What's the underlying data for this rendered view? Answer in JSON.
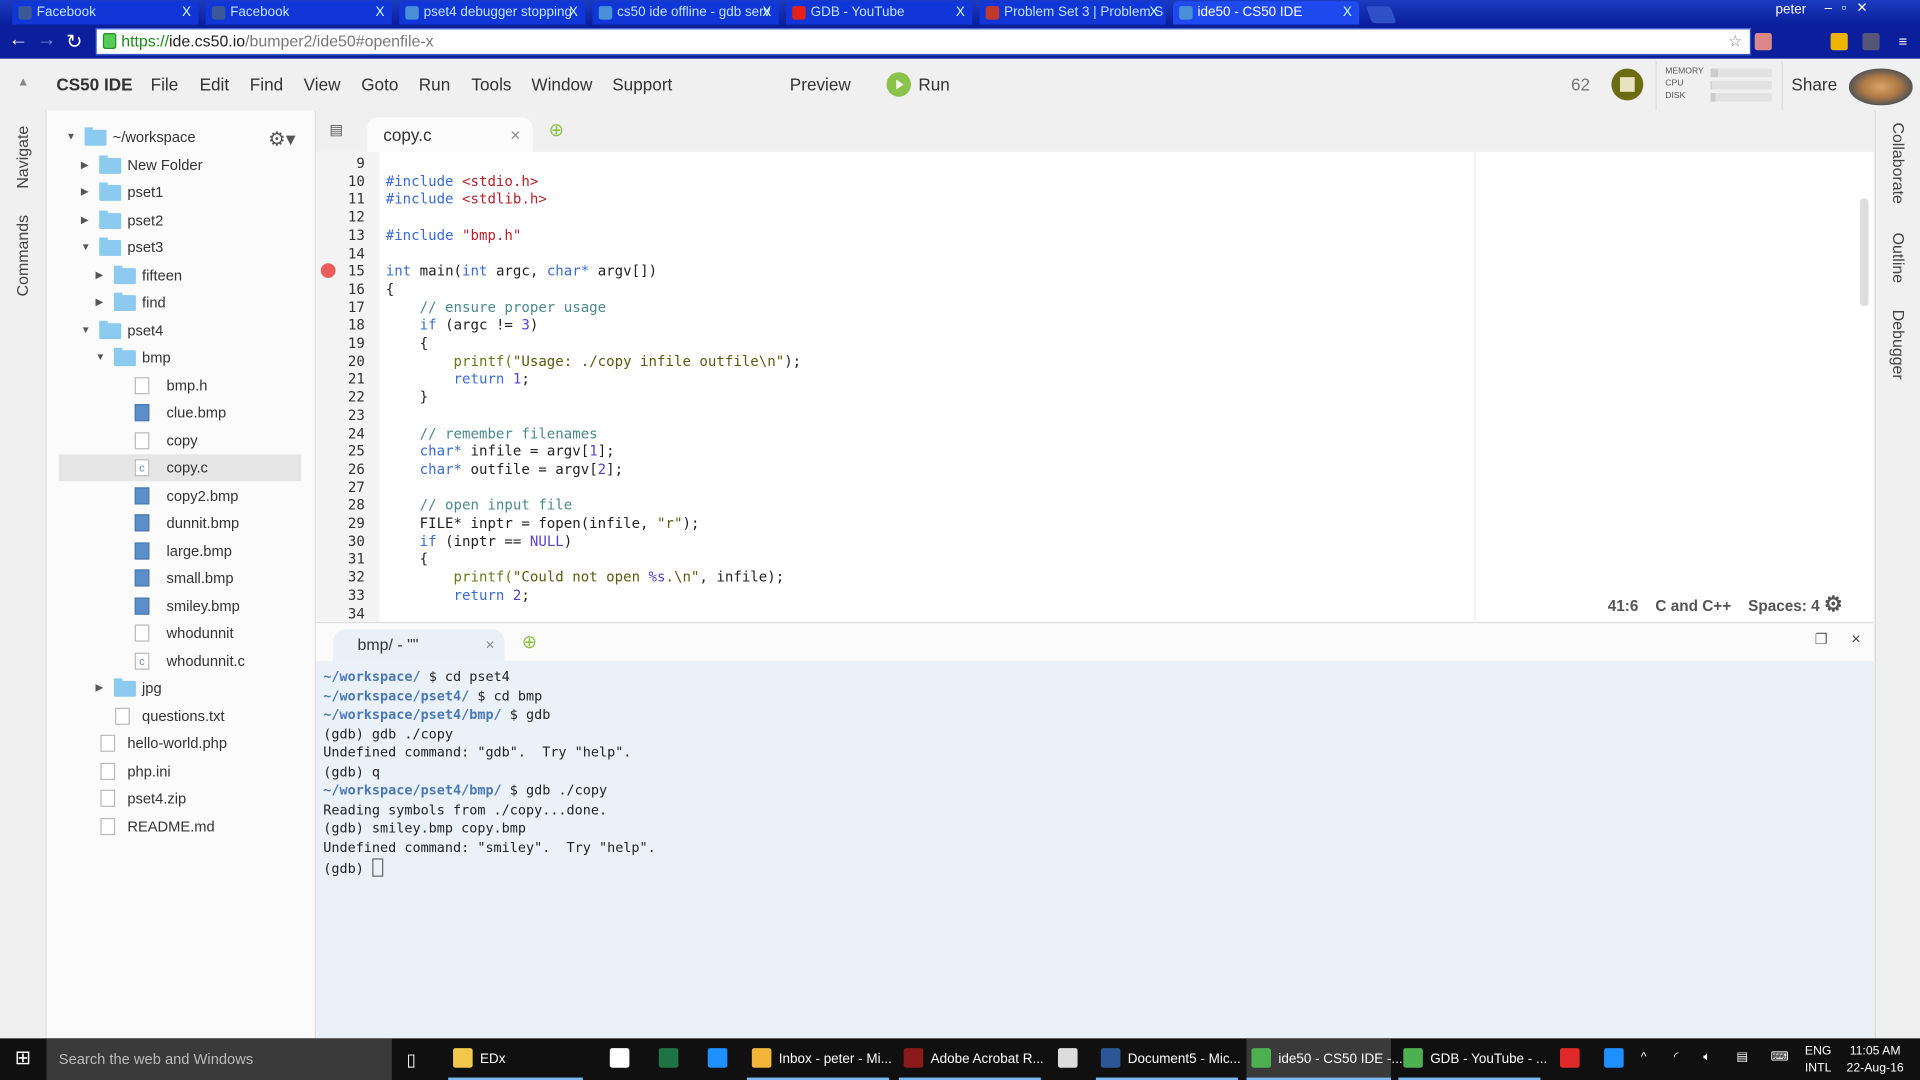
{
  "browser": {
    "tabs": [
      {
        "title": "Facebook",
        "icon": "facebook-icon",
        "color": "#3b5998"
      },
      {
        "title": "Facebook",
        "icon": "facebook-icon",
        "color": "#3b5998"
      },
      {
        "title": "pset4 debugger stopping",
        "icon": "discuss-icon",
        "color": "#4a90d9"
      },
      {
        "title": "cs50 ide offline - gdb serv",
        "icon": "discuss-icon",
        "color": "#4a90d9"
      },
      {
        "title": "GDB - YouTube",
        "icon": "youtube-icon",
        "color": "#e62117"
      },
      {
        "title": "Problem Set 3 | Problem S",
        "icon": "edx-icon",
        "color": "#c0392b"
      },
      {
        "title": "ide50 - CS50 IDE",
        "icon": "cloud9-icon",
        "color": "#4a90d9",
        "active": true
      }
    ],
    "tab_close": "X",
    "user": "peter",
    "url_scheme": "https://",
    "url_host": "ide.cs50.io",
    "url_path": "/bumper2/ide50#openfile-x"
  },
  "ide": {
    "brand": "CS50 IDE",
    "menu": [
      "File",
      "Edit",
      "Find",
      "View",
      "Goto",
      "Run",
      "Tools",
      "Window",
      "Support"
    ],
    "preview": "Preview",
    "run": "Run",
    "count": "62",
    "meters": [
      {
        "label": "MEMORY",
        "value": 0.12
      },
      {
        "label": "CPU",
        "value": 0.02
      },
      {
        "label": "DISK",
        "value": 0.08
      }
    ],
    "share": "Share",
    "left_panels": [
      "Navigate",
      "Commands"
    ],
    "right_panels": [
      "Collaborate",
      "Outline",
      "Debugger"
    ]
  },
  "tree": {
    "nodes": [
      {
        "label": "~/workspace",
        "type": "folder",
        "depth": 0,
        "arrow": "down"
      },
      {
        "label": "New Folder",
        "type": "folder",
        "depth": 1,
        "arrow": "right"
      },
      {
        "label": "pset1",
        "type": "folder",
        "depth": 1,
        "arrow": "right"
      },
      {
        "label": "pset2",
        "type": "folder",
        "depth": 1,
        "arrow": "right"
      },
      {
        "label": "pset3",
        "type": "folder",
        "depth": 1,
        "arrow": "down"
      },
      {
        "label": "fifteen",
        "type": "folder",
        "depth": 2,
        "arrow": "right"
      },
      {
        "label": "find",
        "type": "folder",
        "depth": 2,
        "arrow": "right"
      },
      {
        "label": "pset4",
        "type": "folder",
        "depth": 1,
        "arrow": "down"
      },
      {
        "label": "bmp",
        "type": "folder",
        "depth": 2,
        "arrow": "down"
      },
      {
        "label": "bmp.h",
        "type": "h",
        "depth": 3
      },
      {
        "label": "clue.bmp",
        "type": "img",
        "depth": 3
      },
      {
        "label": "copy",
        "type": "file",
        "depth": 3
      },
      {
        "label": "copy.c",
        "type": "c",
        "depth": 3,
        "selected": true
      },
      {
        "label": "copy2.bmp",
        "type": "img",
        "depth": 3
      },
      {
        "label": "dunnit.bmp",
        "type": "img",
        "depth": 3
      },
      {
        "label": "large.bmp",
        "type": "img",
        "depth": 3
      },
      {
        "label": "small.bmp",
        "type": "img",
        "depth": 3
      },
      {
        "label": "smiley.bmp",
        "type": "img",
        "depth": 3
      },
      {
        "label": "whodunnit",
        "type": "file",
        "depth": 3
      },
      {
        "label": "whodunnit.c",
        "type": "c",
        "depth": 3
      },
      {
        "label": "jpg",
        "type": "folder",
        "depth": 2,
        "arrow": "right"
      },
      {
        "label": "questions.txt",
        "type": "file",
        "depth": 2
      },
      {
        "label": "hello-world.php",
        "type": "php",
        "depth": 1
      },
      {
        "label": "php.ini",
        "type": "file",
        "depth": 1
      },
      {
        "label": "pset4.zip",
        "type": "zip",
        "depth": 1
      },
      {
        "label": "README.md",
        "type": "file",
        "depth": 1
      }
    ]
  },
  "editor": {
    "tab": "copy.c",
    "breakpoint_line": 15,
    "lines": [
      {
        "n": "9",
        "t": []
      },
      {
        "n": "10",
        "t": [
          [
            "#include ",
            "kw"
          ],
          [
            "<stdio.h>",
            "str"
          ]
        ]
      },
      {
        "n": "11",
        "t": [
          [
            "#include ",
            "kw"
          ],
          [
            "<stdlib.h>",
            "str"
          ]
        ]
      },
      {
        "n": "12",
        "t": []
      },
      {
        "n": "13",
        "t": [
          [
            "#include ",
            "kw"
          ],
          [
            "\"bmp.h\"",
            "str"
          ]
        ]
      },
      {
        "n": "14",
        "t": []
      },
      {
        "n": "15",
        "t": [
          [
            "int",
            "kw"
          ],
          [
            " main(",
            ""
          ],
          [
            "int",
            "kw"
          ],
          [
            " argc, ",
            ""
          ],
          [
            "char*",
            "kw"
          ],
          [
            " argv[])",
            ""
          ]
        ]
      },
      {
        "n": "16",
        "t": [
          [
            "{",
            ""
          ]
        ]
      },
      {
        "n": "17",
        "t": [
          [
            "    // ensure proper usage",
            "cm"
          ]
        ]
      },
      {
        "n": "18",
        "t": [
          [
            "    ",
            ""
          ],
          [
            "if",
            "kw"
          ],
          [
            " (argc != ",
            ""
          ],
          [
            "3",
            "lit"
          ],
          [
            ")",
            ""
          ]
        ]
      },
      {
        "n": "19",
        "t": [
          [
            "    {",
            ""
          ]
        ]
      },
      {
        "n": "20",
        "t": [
          [
            "        printf(",
            "fn"
          ],
          [
            "\"Usage: ./copy infile outfile\\n\"",
            "gs"
          ],
          [
            ");",
            ""
          ]
        ]
      },
      {
        "n": "21",
        "t": [
          [
            "        ",
            ""
          ],
          [
            "return",
            "kw"
          ],
          [
            " ",
            ""
          ],
          [
            "1",
            "lit"
          ],
          [
            ";",
            ""
          ]
        ]
      },
      {
        "n": "22",
        "t": [
          [
            "    }",
            ""
          ]
        ]
      },
      {
        "n": "23",
        "t": []
      },
      {
        "n": "24",
        "t": [
          [
            "    // remember filenames",
            "cm"
          ]
        ]
      },
      {
        "n": "25",
        "t": [
          [
            "    ",
            ""
          ],
          [
            "char*",
            "kw"
          ],
          [
            " infile = argv[",
            ""
          ],
          [
            "1",
            "lit"
          ],
          [
            "];",
            ""
          ]
        ]
      },
      {
        "n": "26",
        "t": [
          [
            "    ",
            ""
          ],
          [
            "char*",
            "kw"
          ],
          [
            " outfile = argv[",
            ""
          ],
          [
            "2",
            "lit"
          ],
          [
            "];",
            ""
          ]
        ]
      },
      {
        "n": "27",
        "t": []
      },
      {
        "n": "28",
        "t": [
          [
            "    // open input file",
            "cm"
          ]
        ]
      },
      {
        "n": "29",
        "t": [
          [
            "    FILE* inptr = fopen(infile, ",
            ""
          ],
          [
            "\"r\"",
            "gs"
          ],
          [
            ");",
            ""
          ]
        ]
      },
      {
        "n": "30",
        "t": [
          [
            "    ",
            ""
          ],
          [
            "if",
            "kw"
          ],
          [
            " (inptr == ",
            ""
          ],
          [
            "NULL",
            "lit"
          ],
          [
            ")",
            ""
          ]
        ]
      },
      {
        "n": "31",
        "t": [
          [
            "    {",
            ""
          ]
        ]
      },
      {
        "n": "32",
        "t": [
          [
            "        printf(",
            "fn"
          ],
          [
            "\"Could not open ",
            "gs"
          ],
          [
            "%s",
            "lit"
          ],
          [
            ".\\n\"",
            "gs"
          ],
          [
            ", infile);",
            ""
          ]
        ]
      },
      {
        "n": "33",
        "t": [
          [
            "        ",
            ""
          ],
          [
            "return",
            "kw"
          ],
          [
            " ",
            ""
          ],
          [
            "2",
            "lit"
          ],
          [
            ";",
            ""
          ]
        ]
      },
      {
        "n": "34",
        "t": []
      }
    ],
    "status": {
      "position": "41:6",
      "language": "C and C++",
      "spaces": "Spaces: 4"
    }
  },
  "terminal": {
    "tab": "bmp/ - \"\"",
    "lines": [
      {
        "prompt": "~/workspace/",
        "text": " $ cd pset4"
      },
      {
        "prompt": "~/workspace/pset4/",
        "text": " $ cd bmp"
      },
      {
        "prompt": "~/workspace/pset4/bmp/",
        "text": " $ gdb"
      },
      {
        "prompt": "",
        "text": "(gdb) gdb ./copy"
      },
      {
        "prompt": "",
        "text": "Undefined command: \"gdb\".  Try \"help\"."
      },
      {
        "prompt": "",
        "text": "(gdb) q"
      },
      {
        "prompt": "~/workspace/pset4/bmp/",
        "text": " $ gdb ./copy"
      },
      {
        "prompt": "",
        "text": "Reading symbols from ./copy...done."
      },
      {
        "prompt": "",
        "text": "(gdb) smiley.bmp copy.bmp"
      },
      {
        "prompt": "",
        "text": "Undefined command: \"smiley\".  Try \"help\"."
      },
      {
        "prompt": "",
        "text": "(gdb) ",
        "cursor": true
      }
    ]
  },
  "taskbar": {
    "search": "Search the web and Windows",
    "items": [
      {
        "label": "EDx",
        "icon": "folder-icon",
        "color": "#f3c74a",
        "open": true
      },
      {
        "label": "",
        "icon": "store-icon",
        "color": "#fff"
      },
      {
        "label": "",
        "icon": "excel-icon",
        "color": "#1f7244"
      },
      {
        "label": "",
        "icon": "help-icon",
        "color": "#1e90ff"
      },
      {
        "label": "Inbox - peter - Mi...",
        "icon": "outlook-icon",
        "color": "#f3b43a",
        "open": true
      },
      {
        "label": "Adobe Acrobat R...",
        "icon": "acrobat-icon",
        "color": "#8b1a1a",
        "open": true
      },
      {
        "label": "",
        "icon": "calculator-icon",
        "color": "#ddd"
      },
      {
        "label": "Document5 - Mic...",
        "icon": "word-icon",
        "color": "#2b5797",
        "open": true
      },
      {
        "label": "ide50 - CS50 IDE -...",
        "icon": "chrome-icon",
        "color": "#4caf50",
        "open": true,
        "active": true
      },
      {
        "label": "GDB - YouTube - ...",
        "icon": "chrome-icon",
        "color": "#4caf50",
        "open": true
      },
      {
        "label": "",
        "icon": "flipboard-icon",
        "color": "#e12828"
      },
      {
        "label": "",
        "icon": "help-icon",
        "color": "#1e90ff"
      }
    ],
    "lang": "ENG",
    "layout": "INTL",
    "time": "11:05 AM",
    "date": "22-Aug-16"
  }
}
